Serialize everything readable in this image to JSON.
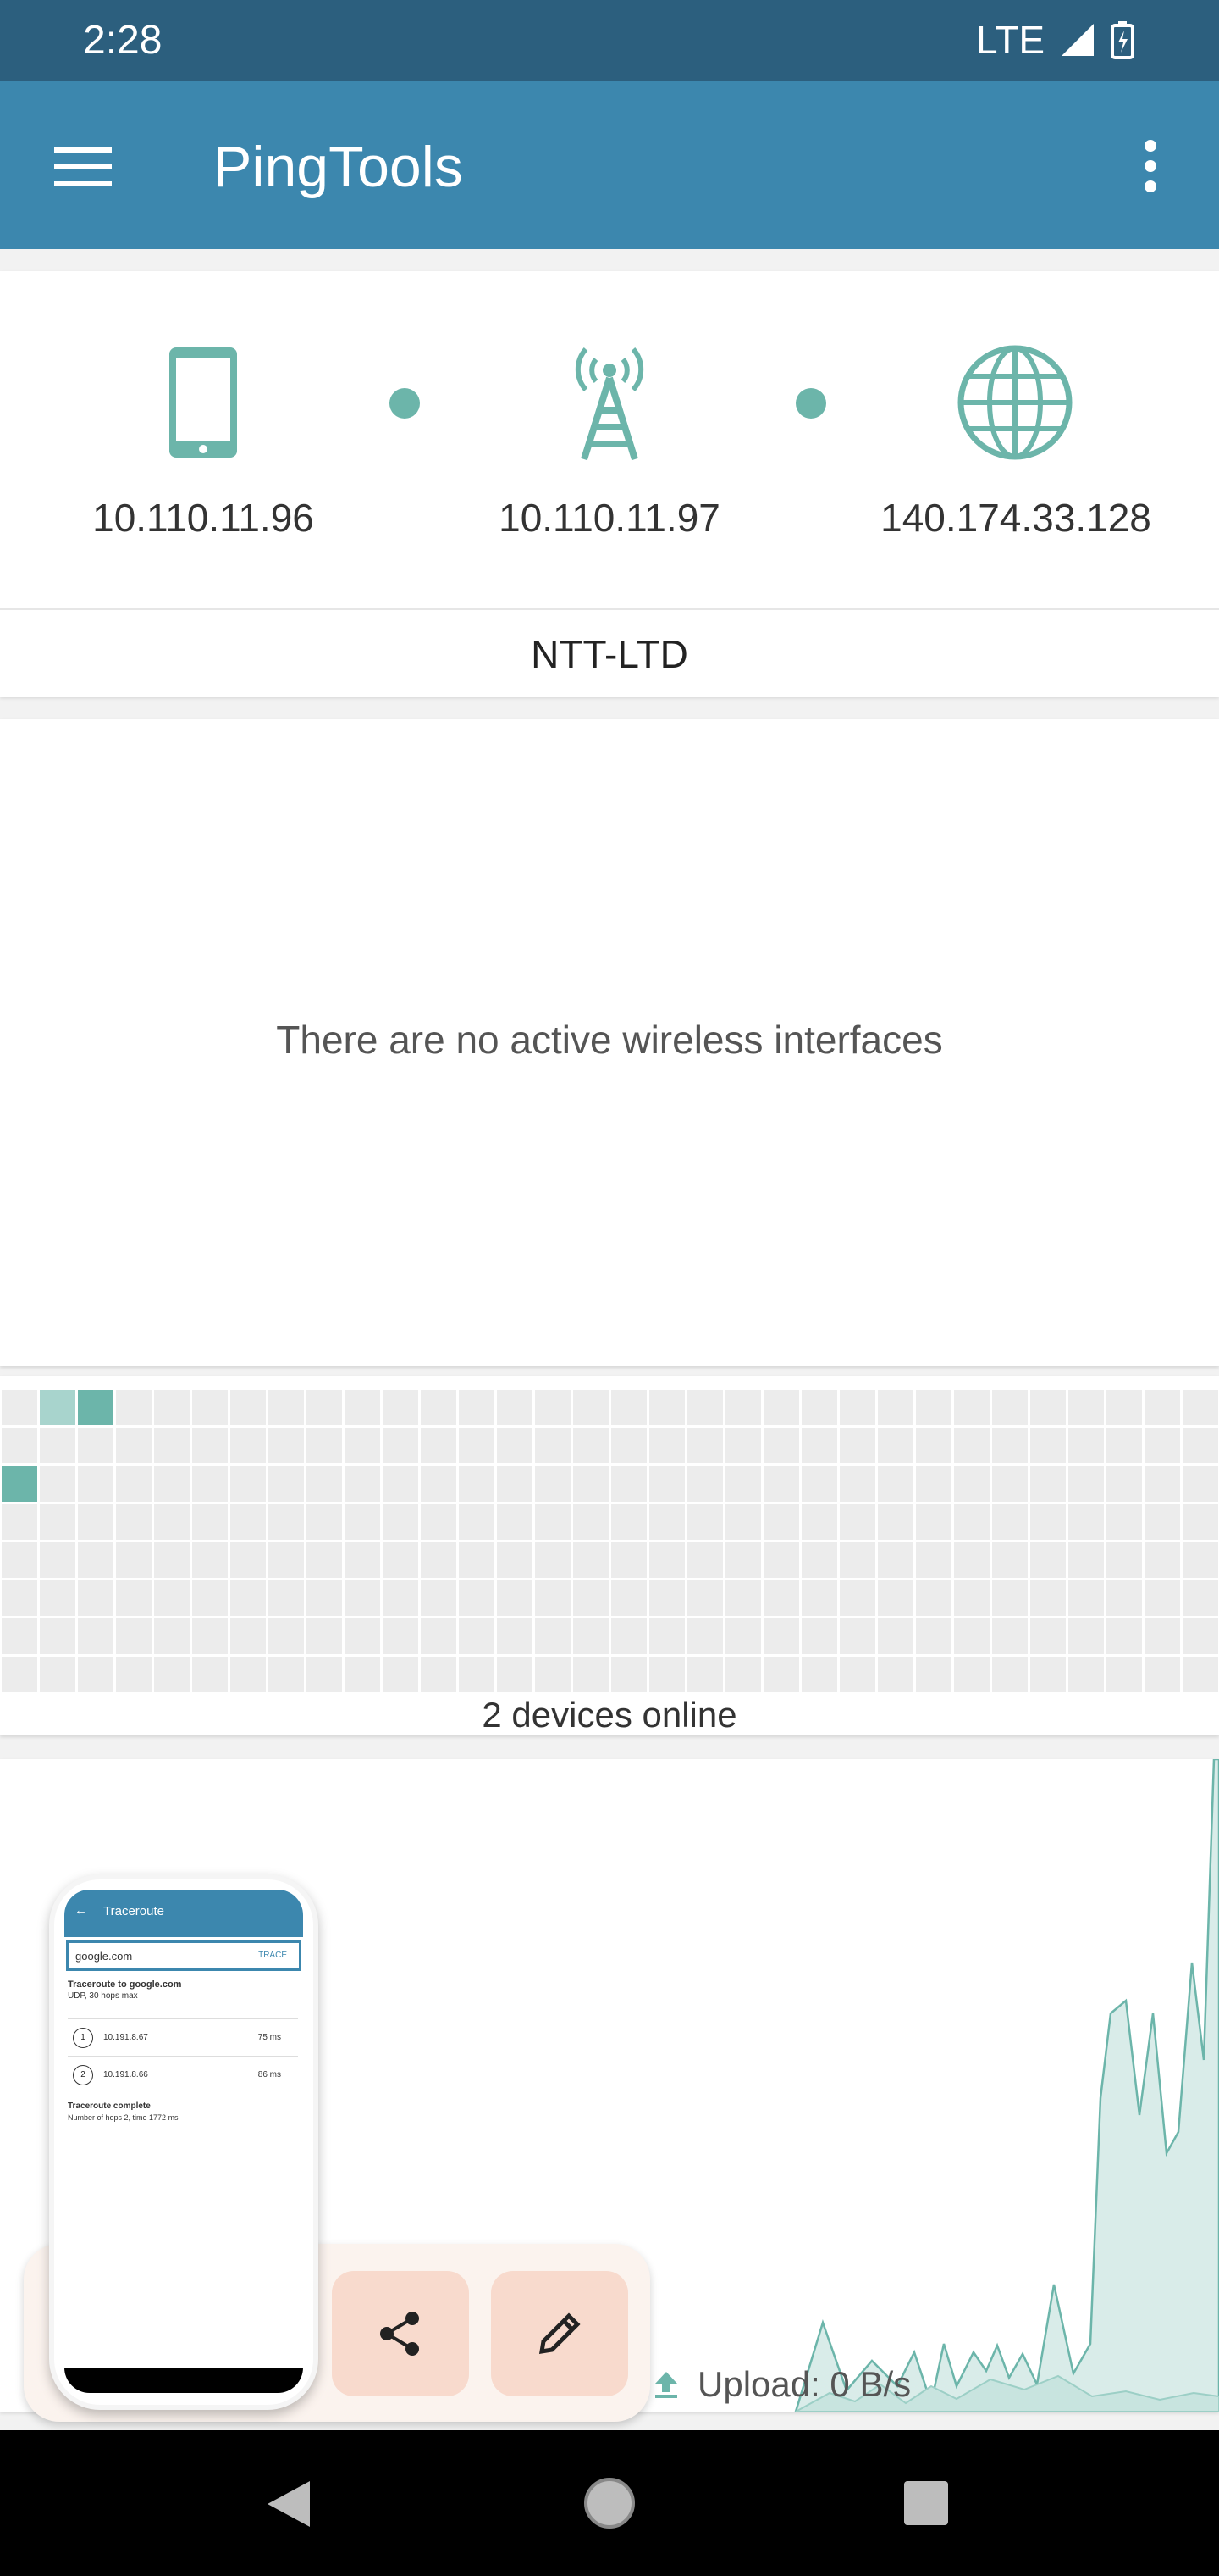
{
  "status_bar": {
    "time": "2:28",
    "network": "LTE"
  },
  "app_bar": {
    "title": "PingTools",
    "menu_icon": "hamburger-menu-icon",
    "more_icon": "more-vert-icon"
  },
  "network_path": {
    "nodes": [
      {
        "icon": "smartphone-icon",
        "ip": "10.110.11.96"
      },
      {
        "icon": "cell-tower-icon",
        "ip": "10.110.11.97"
      },
      {
        "icon": "globe-icon",
        "ip": "140.174.33.128"
      }
    ],
    "isp": "NTT-LTD"
  },
  "wireless": {
    "message": "There are no active wireless interfaces"
  },
  "lan_grid": {
    "devices_label": "2 devices online",
    "active_cells": [
      1,
      2,
      64
    ]
  },
  "traffic": {
    "upload_label": "Upload: 0 B/s"
  },
  "fab": {
    "share_icon": "share-icon",
    "edit_icon": "edit-pencil-icon"
  },
  "overlay_preview": {
    "title": "Traceroute",
    "input": "google.com",
    "action": "TRACE",
    "header": "Traceroute to google.com",
    "subheader": "UDP, 30 hops max",
    "hops": [
      {
        "n": "1",
        "ip": "10.191.8.67",
        "time": "75 ms"
      },
      {
        "n": "2",
        "ip": "10.191.8.66",
        "time": "86 ms"
      }
    ],
    "footer_title": "Traceroute complete",
    "footer_sub": "Number of hops 2, time 1772 ms"
  },
  "colors": {
    "status_bar": "#2c5f7e",
    "app_bar": "#3c87ae",
    "accent": "#6cb5aa"
  }
}
